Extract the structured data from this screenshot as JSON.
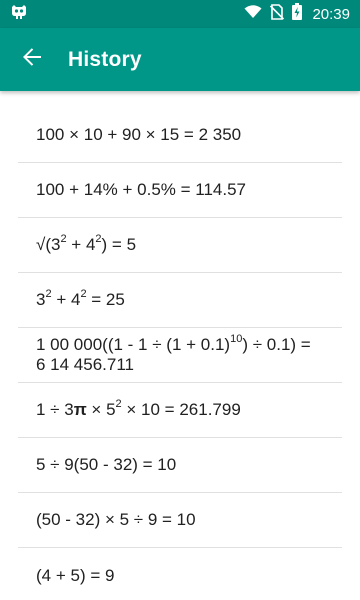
{
  "status_bar": {
    "time": "20:39",
    "icons": [
      "android-debug-icon",
      "wifi-icon",
      "no-sim-icon",
      "battery-charging-icon"
    ]
  },
  "app_bar": {
    "title": "History",
    "back_icon": "arrow-back-icon"
  },
  "colors": {
    "status_bar": "#00897b",
    "app_bar": "#009688",
    "text": "#212121",
    "divider": "#e0e0e0"
  },
  "history": [
    {
      "html": "100 × 10 + 90 × 15 = 2 350",
      "text": "100 × 10 + 90 × 15 = 2 350"
    },
    {
      "html": "100 + 14% + 0.5% = 114.57",
      "text": "100 + 14% + 0.5% = 114.57"
    },
    {
      "html": "√(3<sup>2</sup> + 4<sup>2</sup>) = 5",
      "text": "√(32 + 42) = 5"
    },
    {
      "html": "3<sup>2</sup> + 4<sup>2</sup> = 25",
      "text": "32 + 42 = 25"
    },
    {
      "html": "1 00 000((1 - 1 ÷ (1 + 0.1)<sup>10</sup>) ÷ 0.1) =<br>6 14 456.711",
      "text": "1 00 000((1 - 1 ÷ (1 + 0.1)10) ÷ 0.1) = 6 14 456.711"
    },
    {
      "html": "1 ÷ 3<b>π</b> × 5<sup>2</sup> × 10 = 261.799",
      "text": "1 ÷ 3π × 52 × 10 = 261.799"
    },
    {
      "html": "5 ÷ 9(50 - 32) = 10",
      "text": "5 ÷ 9(50 - 32) = 10"
    },
    {
      "html": "(50 - 32) × 5 ÷ 9 = 10",
      "text": "(50 - 32) × 5 ÷ 9 = 10"
    },
    {
      "html": "(4 + 5) = 9",
      "text": "(4 + 5) = 9"
    }
  ]
}
